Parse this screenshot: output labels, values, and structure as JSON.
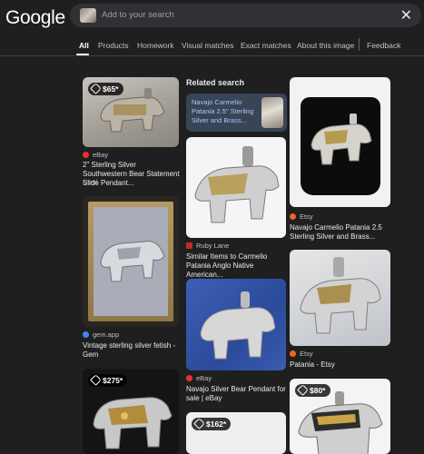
{
  "header": {
    "logo": "Google",
    "search_placeholder": "Add to your search"
  },
  "tabs": [
    {
      "label": "All",
      "active": true
    },
    {
      "label": "Products"
    },
    {
      "label": "Homework"
    },
    {
      "label": "Visual matches"
    },
    {
      "label": "Exact matches"
    },
    {
      "label": "About this image"
    },
    {
      "label": "Feedback"
    }
  ],
  "related": {
    "heading": "Related search",
    "query": "Navajo Carmelio Patania 2.5\" Sterling Silver and Brass..."
  },
  "results": [
    {
      "price": "$65*",
      "source": "eBay",
      "title": "2\" Sterling Silver Southwestern Bear Statement Slide Pendant...",
      "subtitle": "Used"
    },
    {
      "source": "gem.app",
      "title": "Vintage sterling silver fetish - Gem"
    },
    {
      "price": "$275*"
    },
    {
      "source": "Ruby Lane",
      "title": "Similar Items to Carmelio Patania Anglo Native American..."
    },
    {
      "source": "eBay",
      "title": "Navajo Silver Bear Pendant for sale | eBay"
    },
    {
      "price": "$162*"
    },
    {
      "source": "Etsy",
      "title": "Navajo Carmelio Patania 2.5 Sterling Silver and Brass..."
    },
    {
      "source": "Etsy",
      "title": "Patania - Etsy"
    },
    {
      "price": "$80*"
    }
  ],
  "colors": {
    "background": "#1f1f1f",
    "link": "#a8c7fa",
    "ebay": "#e53238",
    "etsy": "#f1641e",
    "rubylane": "#c62828"
  }
}
